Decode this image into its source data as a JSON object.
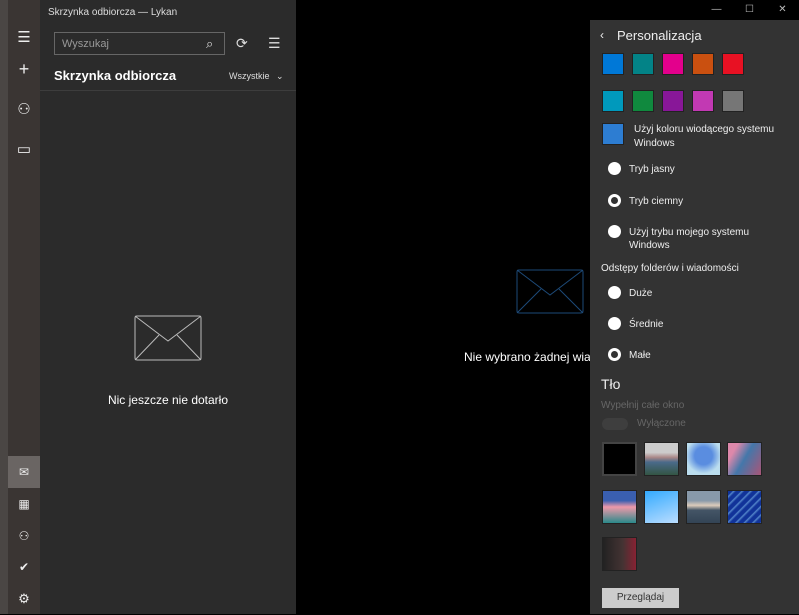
{
  "window": {
    "title": "Skrzynka odbiorcza — Lykan",
    "controls": [
      "—",
      "☐",
      "✕"
    ]
  },
  "nav": {
    "icons": [
      "menu-icon",
      "compose-icon",
      "account-icon",
      "folder-icon",
      "mail-icon",
      "calendar-icon",
      "people-icon",
      "todo-icon",
      "settings-icon"
    ]
  },
  "folder_pane": {
    "search_placeholder": "Wyszukaj",
    "heading": "Skrzynka odbiorcza",
    "filter": "Wszystkie",
    "empty_text": "Nic jeszcze nie dotarło"
  },
  "reading_pane": {
    "empty_text": "Nie wybrano żadnej wiadomości"
  },
  "settings": {
    "title": "Personalizacja",
    "accent_colors": [
      "#0078d7",
      "#038387",
      "#e3008c",
      "#ca5010",
      "#e81123",
      "#0099bc",
      "#10893e",
      "#881798",
      "#c239b3",
      "#767676"
    ],
    "system_accent_color": "#2d7dd2",
    "system_accent_label": "Użyj koloru wiodącego systemu Windows",
    "modes": [
      {
        "label": "Tryb jasny",
        "selected": false
      },
      {
        "label": "Tryb ciemny",
        "selected": true
      },
      {
        "label": "Użyj trybu mojego systemu Windows",
        "selected": false
      }
    ],
    "spacing_label": "Odstępy folderów i wiadomości",
    "spacing": [
      {
        "label": "Duże",
        "selected": false
      },
      {
        "label": "Średnie",
        "selected": false
      },
      {
        "label": "Małe",
        "selected": true
      }
    ],
    "background_heading": "Tło",
    "fill_label": "Wypełnij całe okno",
    "fill_toggle": "Wyłączone",
    "browse": "Przeglądaj"
  }
}
